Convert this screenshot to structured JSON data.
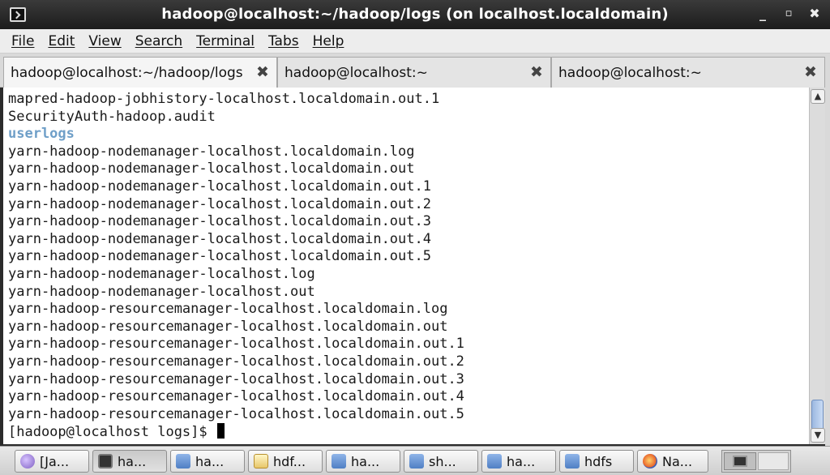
{
  "window": {
    "title": "hadoop@localhost:~/hadoop/logs (on localhost.localdomain)",
    "controls": [
      "_",
      "▫",
      "✖"
    ]
  },
  "menubar": [
    "File",
    "Edit",
    "View",
    "Search",
    "Terminal",
    "Tabs",
    "Help"
  ],
  "tabs": [
    {
      "label": "hadoop@localhost:~/hadoop/logs",
      "active": true
    },
    {
      "label": "hadoop@localhost:~",
      "active": false
    },
    {
      "label": "hadoop@localhost:~",
      "active": false
    }
  ],
  "tab_close_glyph": "✖",
  "terminal": {
    "lines": [
      {
        "text": "mapred-hadoop-jobhistory-localhost.localdomain.out.1",
        "kind": "file"
      },
      {
        "text": "SecurityAuth-hadoop.audit",
        "kind": "file"
      },
      {
        "text": "userlogs",
        "kind": "dir"
      },
      {
        "text": "yarn-hadoop-nodemanager-localhost.localdomain.log",
        "kind": "file"
      },
      {
        "text": "yarn-hadoop-nodemanager-localhost.localdomain.out",
        "kind": "file"
      },
      {
        "text": "yarn-hadoop-nodemanager-localhost.localdomain.out.1",
        "kind": "file"
      },
      {
        "text": "yarn-hadoop-nodemanager-localhost.localdomain.out.2",
        "kind": "file"
      },
      {
        "text": "yarn-hadoop-nodemanager-localhost.localdomain.out.3",
        "kind": "file"
      },
      {
        "text": "yarn-hadoop-nodemanager-localhost.localdomain.out.4",
        "kind": "file"
      },
      {
        "text": "yarn-hadoop-nodemanager-localhost.localdomain.out.5",
        "kind": "file"
      },
      {
        "text": "yarn-hadoop-nodemanager-localhost.log",
        "kind": "file"
      },
      {
        "text": "yarn-hadoop-nodemanager-localhost.out",
        "kind": "file"
      },
      {
        "text": "yarn-hadoop-resourcemanager-localhost.localdomain.log",
        "kind": "file"
      },
      {
        "text": "yarn-hadoop-resourcemanager-localhost.localdomain.out",
        "kind": "file"
      },
      {
        "text": "yarn-hadoop-resourcemanager-localhost.localdomain.out.1",
        "kind": "file"
      },
      {
        "text": "yarn-hadoop-resourcemanager-localhost.localdomain.out.2",
        "kind": "file"
      },
      {
        "text": "yarn-hadoop-resourcemanager-localhost.localdomain.out.3",
        "kind": "file"
      },
      {
        "text": "yarn-hadoop-resourcemanager-localhost.localdomain.out.4",
        "kind": "file"
      },
      {
        "text": "yarn-hadoop-resourcemanager-localhost.localdomain.out.5",
        "kind": "file"
      }
    ],
    "prompt": "[hadoop@localhost logs]$ ",
    "dir_color": "#6f9fc8"
  },
  "scrollbar": {
    "up_glyph": "▲",
    "down_glyph": "▼"
  },
  "taskbar": {
    "items": [
      {
        "label": "[Ja...",
        "icon": "circle-icon",
        "active": false
      },
      {
        "label": "ha...",
        "icon": "terminal-icon",
        "active": true
      },
      {
        "label": "ha...",
        "icon": "folder-icon",
        "active": false
      },
      {
        "label": "hdf...",
        "icon": "text-editor-icon",
        "active": false
      },
      {
        "label": "ha...",
        "icon": "folder-icon",
        "active": false
      },
      {
        "label": "sh...",
        "icon": "folder-icon",
        "active": false
      },
      {
        "label": "ha...",
        "icon": "folder-icon",
        "active": false
      },
      {
        "label": "hdfs",
        "icon": "folder-icon",
        "active": false
      },
      {
        "label": "Na...",
        "icon": "firefox-icon",
        "active": false
      }
    ]
  }
}
